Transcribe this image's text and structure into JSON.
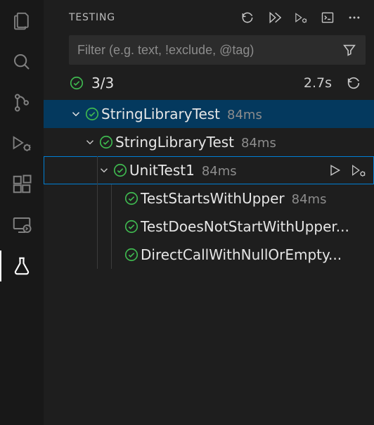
{
  "panel": {
    "title": "TESTING"
  },
  "filter": {
    "placeholder": "Filter (e.g. text, !exclude, @tag)"
  },
  "status": {
    "ratio": "3/3",
    "duration": "2.7s"
  },
  "tree": {
    "root": {
      "label": "StringLibraryTest",
      "desc": "84ms"
    },
    "ns": {
      "label": "StringLibraryTest",
      "desc": "84ms"
    },
    "class": {
      "label": "UnitTest1",
      "desc": "84ms"
    },
    "tests": {
      "t1": {
        "label": "TestStartsWithUpper",
        "desc": "84ms"
      },
      "t2": {
        "label": "TestDoesNotStartWithUpper...",
        "desc": ""
      },
      "t3": {
        "label": "DirectCallWithNullOrEmpty...",
        "desc": ""
      }
    }
  },
  "icons": {
    "explorer": "explorer-icon",
    "search": "search-icon",
    "scm": "source-control-icon",
    "debug": "debug-play-icon",
    "extensions": "extensions-icon",
    "remote": "remote-icon",
    "testing": "beaker-icon",
    "refresh": "refresh-icon",
    "runAll": "run-all-icon",
    "debugAll": "debug-all-icon",
    "showOutput": "terminal-output-icon",
    "more": "more-icon",
    "filterFunnel": "filter-funnel-icon",
    "refreshSmall": "refresh-icon",
    "run": "play-icon"
  }
}
